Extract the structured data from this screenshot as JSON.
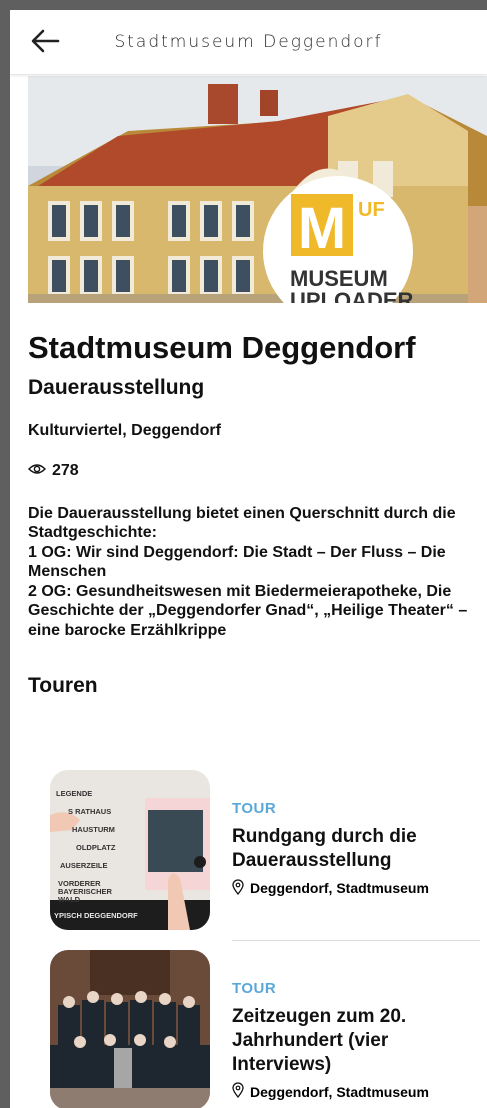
{
  "header": {
    "title": "Stadtmuseum Deggendorf"
  },
  "hero": {
    "logo_big_letter": "M",
    "logo_small": "UF",
    "logo_line1": "MUSEUM",
    "logo_line2": "UPLOADER"
  },
  "museum": {
    "name": "Stadtmuseum Deggendorf",
    "subtitle": "Dauerausstellung",
    "location": "Kulturviertel, Deggendorf",
    "views": "278",
    "description": "Die Dauerausstellung bietet einen Querschnitt durch die Stadtgeschichte:\n1 OG: Wir sind Deggendorf: Die Stadt – Der Fluss – Die Menschen\n2 OG: Gesundheitswesen mit Biedermeierapotheke, Die Geschichte der „Deggendorfer Gnad“, „Heilige Theater“ – eine barocke Erzählkrippe"
  },
  "tours_heading": "Touren",
  "tours": [
    {
      "tag": "TOUR",
      "title": "Rundgang durch die Dauerausstellung",
      "location": "Deggendorf, Stadtmuseum",
      "thumb_lines": [
        "LEGENDE",
        "S RATHAUS",
        "HAUSTURM",
        "OLDPLATZ",
        "AUSERZEILE",
        "VORDERER",
        "BAYERISCHER",
        "WALD",
        "YPISCH DEGGENDORF"
      ]
    },
    {
      "tag": "TOUR",
      "title": "Zeitzeugen zum 20. Jahrhundert (vier Interviews)",
      "location": "Deggendorf, Stadtmuseum"
    }
  ]
}
